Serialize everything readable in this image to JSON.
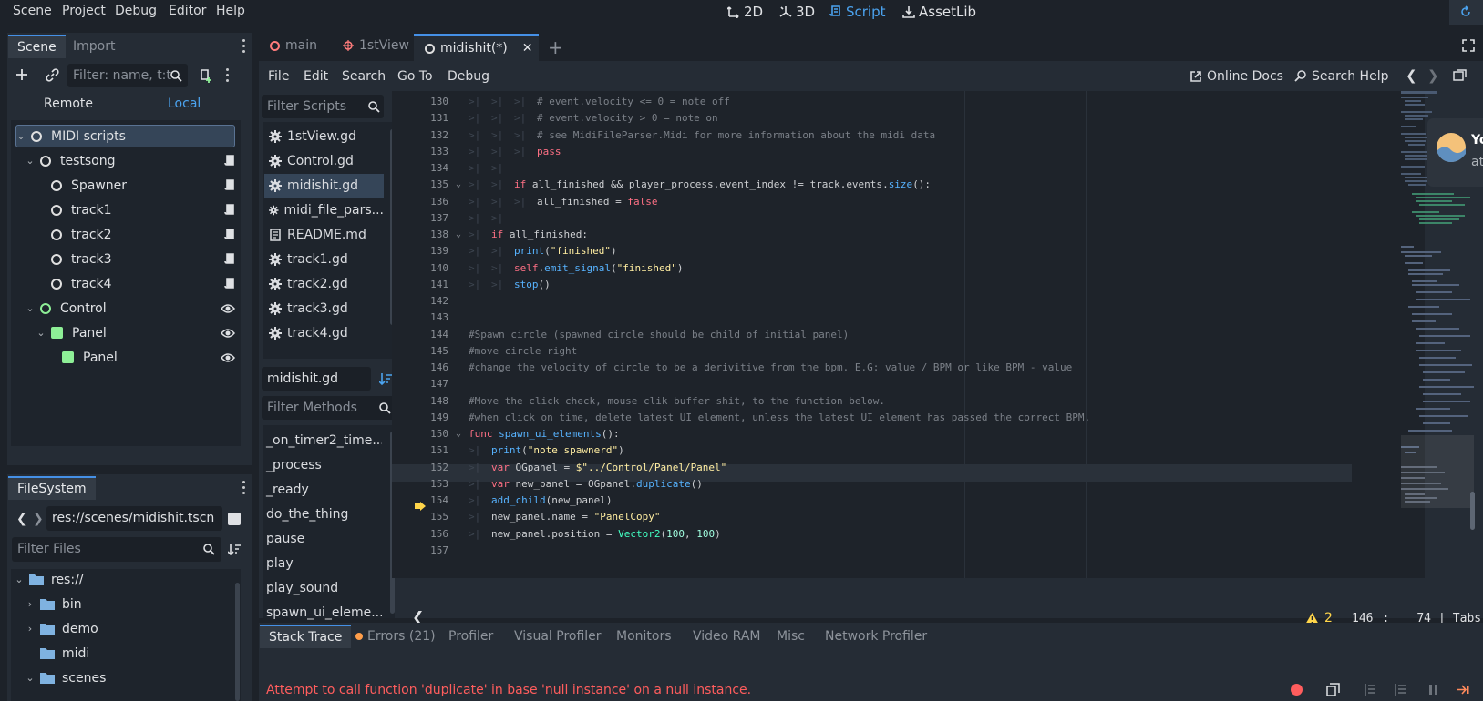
{
  "menu": [
    "Scene",
    "Project",
    "Debug",
    "Editor",
    "Help"
  ],
  "workspaces": [
    {
      "label": "2D",
      "icon": "2d-icon"
    },
    {
      "label": "3D",
      "icon": "3d-icon"
    },
    {
      "label": "Script",
      "icon": "script-icon",
      "active": true
    },
    {
      "label": "AssetLib",
      "icon": "assetlib-icon"
    }
  ],
  "scene_dock": {
    "tabs": [
      "Scene",
      "Import"
    ],
    "filter_placeholder": "Filter: name, t:t",
    "remote_label": "Remote",
    "local_label": "Local",
    "tree": [
      {
        "label": "MIDI scripts",
        "selected": true
      },
      {
        "label": "testsong"
      },
      {
        "label": "Spawner"
      },
      {
        "label": "track1"
      },
      {
        "label": "track2"
      },
      {
        "label": "track3"
      },
      {
        "label": "track4"
      },
      {
        "label": "Control"
      },
      {
        "label": "Panel"
      },
      {
        "label": "Panel"
      }
    ]
  },
  "filesystem": {
    "tab": "FileSystem",
    "path": "res://scenes/midishit.tscn",
    "filter_placeholder": "Filter Files",
    "items": [
      "res://",
      "bin",
      "demo",
      "midi",
      "scenes"
    ]
  },
  "editor_tabs": [
    {
      "label": "main"
    },
    {
      "label": "1stView"
    },
    {
      "label": "midishit(*)",
      "active": true
    }
  ],
  "script_menu": [
    "File",
    "Edit",
    "Search",
    "Go To",
    "Debug"
  ],
  "script_toolbar": {
    "online_docs": "Online Docs",
    "search_help": "Search Help"
  },
  "scripts": {
    "filter_placeholder": "Filter Scripts",
    "items": [
      "1stView.gd",
      "Control.gd",
      "midishit.gd",
      "midi_file_pars...",
      "README.md",
      "track1.gd",
      "track2.gd",
      "track3.gd",
      "track4.gd"
    ],
    "current": "midishit.gd"
  },
  "methods": {
    "filter_placeholder": "Filter Methods",
    "items": [
      "_on_timer2_time...",
      "_process",
      "_ready",
      "do_the_thing",
      "pause",
      "play",
      "play_sound",
      "spawn_ui_eleme..."
    ]
  },
  "code": {
    "lines": [
      {
        "n": "130",
        "text": "# event.velocity <= 0 = note off"
      },
      {
        "n": "131",
        "text": "# event.velocity > 0 = note on"
      },
      {
        "n": "132",
        "text": "# see MidiFileParser.Midi for more information about the midi data"
      },
      {
        "n": "133",
        "text": "pass"
      },
      {
        "n": "134",
        "text": ""
      },
      {
        "n": "135",
        "text": "if all_finished && player_process.event_index != track.events.size():"
      },
      {
        "n": "136",
        "text": "all_finished = false"
      },
      {
        "n": "137",
        "text": ""
      },
      {
        "n": "138",
        "text": "if all_finished:"
      },
      {
        "n": "139",
        "text": "print(\"finished\")"
      },
      {
        "n": "140",
        "text": "self.emit_signal(\"finished\")"
      },
      {
        "n": "141",
        "text": "stop()"
      },
      {
        "n": "142",
        "text": ""
      },
      {
        "n": "143",
        "text": ""
      },
      {
        "n": "144",
        "text": "#Spawn circle (spawned circle should be child of initial panel)"
      },
      {
        "n": "145",
        "text": "#move circle right"
      },
      {
        "n": "146",
        "text": "#change the velocity of circle to be a derivitive from the bpm. E.G: value / BPM or like BPM - value"
      },
      {
        "n": "147",
        "text": ""
      },
      {
        "n": "148",
        "text": "#Move the click check, mouse clik buffer shit, to the function below."
      },
      {
        "n": "149",
        "text": "#when click on time, delete latest UI element, unless the latest UI element has passed the correct BPM."
      },
      {
        "n": "150",
        "text": "func spawn_ui_elements():"
      },
      {
        "n": "151",
        "text": "print(\"note spawnerd\")"
      },
      {
        "n": "152",
        "text": "var OGpanel = $\"../Control/Panel/Panel\""
      },
      {
        "n": "153",
        "text": "var new_panel = OGpanel.duplicate()"
      },
      {
        "n": "154",
        "text": "add_child(new_panel)"
      },
      {
        "n": "155",
        "text": "new_panel.name = \"PanelCopy\""
      },
      {
        "n": "156",
        "text": "new_panel.position = Vector2(100, 100)"
      },
      {
        "n": "157",
        "text": ""
      }
    ]
  },
  "status": {
    "warnings": "2",
    "line": "146",
    "col": "74",
    "indent": "Tabs"
  },
  "bottom_tabs": [
    "Stack Trace",
    "Errors (21)",
    "Profiler",
    "Visual Profiler",
    "Monitors",
    "Video RAM",
    "Misc",
    "Network Profiler"
  ],
  "error_message": "Attempt to call function 'duplicate' in base 'null instance' on a null instance.",
  "notification": {
    "title": "Yo",
    "subtitle": "at"
  },
  "colors": {
    "accent": "#4590e6",
    "error": "#ff5d5d",
    "node_green": "#8eef97"
  }
}
